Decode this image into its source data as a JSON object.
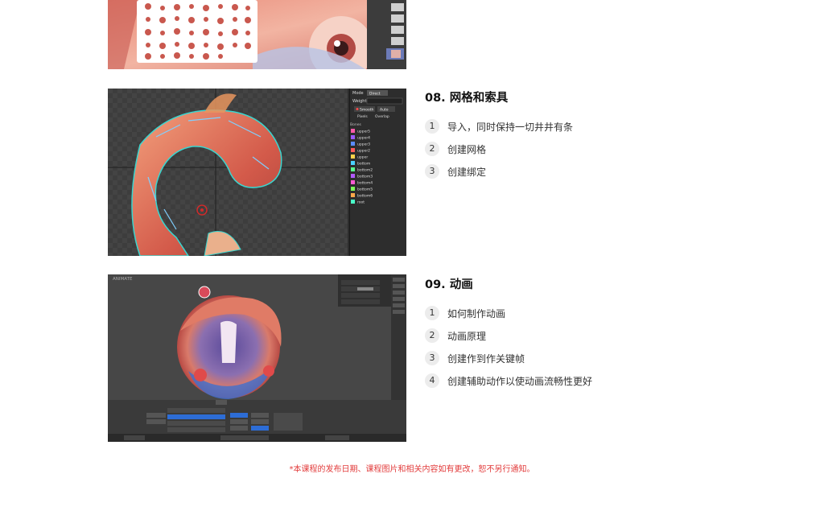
{
  "sections": [
    {
      "title": "08. 网格和索具",
      "steps": [
        {
          "num": "1",
          "text": "导入，同时保持一切井井有条"
        },
        {
          "num": "2",
          "text": "创建网格"
        },
        {
          "num": "3",
          "text": "创建绑定"
        }
      ]
    },
    {
      "title": "09. 动画",
      "steps": [
        {
          "num": "1",
          "text": "如何制作动画"
        },
        {
          "num": "2",
          "text": "动画原理"
        },
        {
          "num": "3",
          "text": "创建作到作关键帧"
        },
        {
          "num": "4",
          "text": "创建辅助动作以使动画流畅性更好"
        }
      ]
    }
  ],
  "screenshots": {
    "mesh_panel": {
      "mode_label": "Mode",
      "mode_value": "Direct",
      "weight_label": "Weight",
      "smooth_button": "Smooth",
      "auto_button": "Auto",
      "pixels_label": "Pixels",
      "overlap_label": "Overlap",
      "bones_header": "Bones",
      "bones": [
        {
          "name": "upper5",
          "color": "#ff5aa8"
        },
        {
          "name": "upper4",
          "color": "#9b59ff"
        },
        {
          "name": "upper3",
          "color": "#5a8cff"
        },
        {
          "name": "upper2",
          "color": "#ff5a5a"
        },
        {
          "name": "upper",
          "color": "#ffd24a"
        },
        {
          "name": "bottom",
          "color": "#4ad1ff"
        },
        {
          "name": "bottom2",
          "color": "#5aff8c"
        },
        {
          "name": "bottom3",
          "color": "#b05aff"
        },
        {
          "name": "bottom4",
          "color": "#ff5ad2"
        },
        {
          "name": "bottom5",
          "color": "#7dff5a"
        },
        {
          "name": "bottom6",
          "color": "#ffa84a"
        },
        {
          "name": "root",
          "color": "#4affc8"
        }
      ]
    },
    "animate_panel": {
      "mode_label": "ANIMATE"
    }
  },
  "colors": {
    "notice": "#e23b3b",
    "mesh_outline": "#39d6d0"
  },
  "notice": "*本课程的发布日期、课程图片和相关内容如有更改，恕不另行通知。"
}
